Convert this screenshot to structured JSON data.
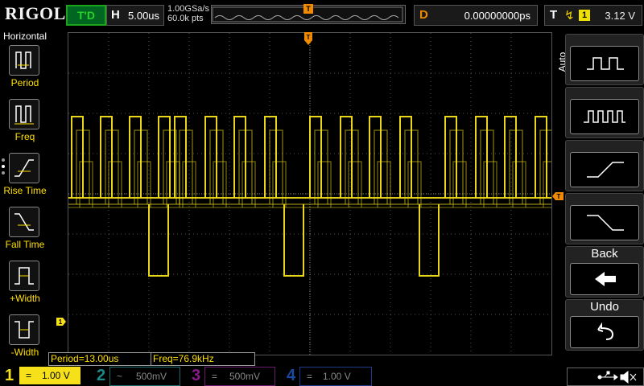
{
  "header": {
    "logo": "RIGOL",
    "run_status": "T'D",
    "timebase_key": "H",
    "timebase_value": "5.00us",
    "sample_rate": "1.00GSa/s",
    "memory_depth": "60.0k pts",
    "trigger_marker": "T",
    "delay_key": "D",
    "delay_value": "0.00000000ps",
    "trigger_key": "T",
    "trigger_edge": "↯",
    "trigger_source": "1",
    "trigger_level": "3.12 V"
  },
  "left_menu": {
    "title": "Horizontal",
    "items": [
      {
        "label": "Period",
        "icon": "period-icon"
      },
      {
        "label": "Freq",
        "icon": "frequency-icon"
      },
      {
        "label": "Rise Time",
        "icon": "rise-time-icon"
      },
      {
        "label": "Fall Time",
        "icon": "fall-time-icon"
      },
      {
        "label": "+Width",
        "icon": "positive-width-icon"
      },
      {
        "label": "-Width",
        "icon": "negative-width-icon"
      }
    ]
  },
  "right_menu": {
    "auto_label": "Auto",
    "keys": [
      {
        "icon": "square-wave-icon"
      },
      {
        "icon": "pulse-train-icon"
      },
      {
        "icon": "rising-edge-icon"
      },
      {
        "icon": "falling-edge-icon"
      },
      {
        "label": "Back",
        "icon": "back-arrow-icon"
      },
      {
        "label": "Undo",
        "icon": "undo-icon"
      }
    ]
  },
  "waveform": {
    "channel_marker": "1",
    "trigger_level_marker": "T",
    "color": "#f5e01a"
  },
  "measurements": {
    "period": "Period=13.00us",
    "freq": "Freq=76.9kHz"
  },
  "channels": [
    {
      "num": "1",
      "coupling": "=",
      "scale": "1.00 V",
      "color": "#f5e01a",
      "active": true
    },
    {
      "num": "2",
      "coupling": "~",
      "scale": "500mV",
      "color": "#1ab0b0",
      "active": false
    },
    {
      "num": "3",
      "coupling": "=",
      "scale": "500mV",
      "color": "#c020c0",
      "active": false
    },
    {
      "num": "4",
      "coupling": "=",
      "scale": "1.00 V",
      "color": "#2060e0",
      "active": false
    }
  ],
  "status_icons": [
    "usb-icon",
    "speaker-muted-icon"
  ]
}
